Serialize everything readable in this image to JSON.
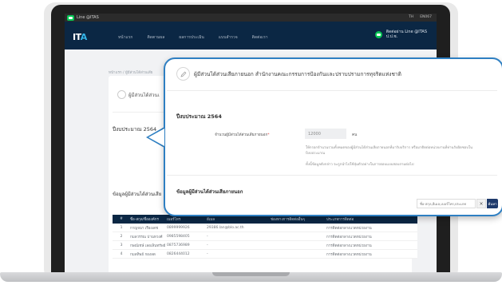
{
  "topbar": {
    "line_label": "Line @ITAS",
    "right_items": [
      "TH",
      "EN067"
    ]
  },
  "navbar": {
    "logo_main": "IT",
    "logo_accent": "A",
    "menu": [
      "หน้าแรก",
      "ติดตามผล",
      "ผลการประเมิน",
      "แบบสำรวจ",
      "ติดต่อเรา"
    ],
    "line_id_line1": "ติดต่อผ่าน Line @ITAS",
    "line_id_line2": "ป.ป.ช."
  },
  "background": {
    "breadcrumb": "หน้าแรก / ผู้มีส่วนได้ส่วนเสีย",
    "card_title": "ผู้มีส่วนได้ส่วนเ",
    "year": "ปีงบประมาณ 2564",
    "section": "ข้อมูลผู้มีส่วนได้ส่วนเสีย"
  },
  "table": {
    "headers": [
      "#",
      "ชื่อ-สกุล/ชื่อองค์กร",
      "เบอร์โทร",
      "อีเมล",
      "ช่องทางการติดต่ออื่นๆ",
      "ประเภทการติดต่อ"
    ],
    "rows": [
      [
        "1",
        "กาญจนา เรืองเดช",
        "0899999926",
        "29386.lan@blo.ac.th",
        "",
        "การติดต่อกลางแวดหน่วยงาน"
      ],
      [
        "2",
        "กมลวรรณ ปานทวงศ์",
        "0985598405",
        "-",
        "",
        "การติดต่อกลางแวดหน่วยงาน"
      ],
      [
        "3",
        "กษณ์เชษ์ เลอเลินทรัพย์",
        "0875736989",
        "-",
        "",
        "การติดต่อกลางแวดหน่วยงาน"
      ],
      [
        "4",
        "กมลทิพย์ กองลด",
        "0826444012",
        "-",
        "",
        "การติดต่อกลางแวดหน่วยงาน"
      ]
    ]
  },
  "callout": {
    "title": "ผู้มีส่วนได้ส่วนเสียภายนอก สำนักงานคณะกรรมการป้องกันและปราบปรามการทุจริตแห่งชาติ",
    "year": "ปีงบประมาณ 2564",
    "field_label": "จำนวนผู้มีส่วนได้ส่วนเสียภายนอก",
    "required_mark": "*",
    "field_value": "12000",
    "field_unit": "คน",
    "note1": "ให้กรอกจำนวนรวมทั้งหมดของผู้มีส่วนได้ส่วนเสียภายนอกที่มารับบริการ หรือมาติดต่อหน่วยงานที่ท่านรับผิดชอบในปีงบประมาณ",
    "note2": "ทั้งนี้ข้อมูลดังกล่าว จะถูกนำไปใช้สุ่มตัวอย่างในการตอบแบบสอบถามต่อไป",
    "section": "ข้อมูลผู้มีส่วนได้ส่วนเสียภายนอก",
    "search_placeholder": "ชื่อ-สกุล,อีเมล,เบอร์โทร,ประเภท",
    "clear_label": "×",
    "find_label": "ค้นหา"
  },
  "colors": {
    "navbar": "#0b2744",
    "callout_border": "#2e7fc2",
    "line_green": "#06c755",
    "find_button": "#1f3a6b"
  },
  "icons": [
    "line-icon",
    "pencil-icon",
    "close-icon"
  ]
}
